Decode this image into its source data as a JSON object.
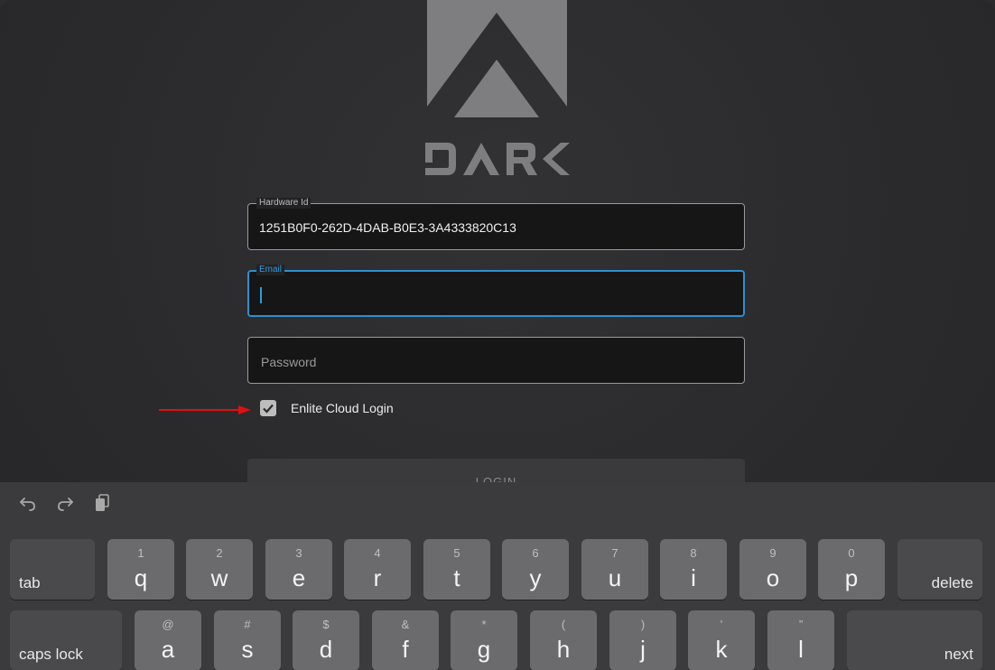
{
  "brand": {
    "wordmark": "DARK",
    "logo": "dark-logo"
  },
  "form": {
    "hardware_id": {
      "label": "Hardware Id",
      "value": "1251B0F0-262D-4DAB-B0E3-3A4333820C13"
    },
    "email": {
      "label": "Email",
      "value": ""
    },
    "password": {
      "placeholder": "Password",
      "value": ""
    },
    "cloud_login": {
      "label": "Enlite Cloud Login",
      "checked": true
    },
    "login_button": "LOGIN"
  },
  "annotation": {
    "arrow_color": "#e01010"
  },
  "colors": {
    "focus": "#2f8fcf",
    "background": "#2b2b2d",
    "field_bg": "#161616"
  },
  "keyboard": {
    "toolbar": [
      "undo-icon",
      "redo-icon",
      "paste-icon"
    ],
    "row1": {
      "left": "tab",
      "keys": [
        {
          "hint": "1",
          "char": "q"
        },
        {
          "hint": "2",
          "char": "w"
        },
        {
          "hint": "3",
          "char": "e"
        },
        {
          "hint": "4",
          "char": "r"
        },
        {
          "hint": "5",
          "char": "t"
        },
        {
          "hint": "6",
          "char": "y"
        },
        {
          "hint": "7",
          "char": "u"
        },
        {
          "hint": "8",
          "char": "i"
        },
        {
          "hint": "9",
          "char": "o"
        },
        {
          "hint": "0",
          "char": "p"
        }
      ],
      "right": "delete"
    },
    "row2": {
      "left": "caps lock",
      "keys": [
        {
          "hint": "@",
          "char": "a"
        },
        {
          "hint": "#",
          "char": "s"
        },
        {
          "hint": "$",
          "char": "d"
        },
        {
          "hint": "&",
          "char": "f"
        },
        {
          "hint": "*",
          "char": "g"
        },
        {
          "hint": "(",
          "char": "h"
        },
        {
          "hint": ")",
          "char": "j"
        },
        {
          "hint": "’",
          "char": "k"
        },
        {
          "hint": "”",
          "char": "l"
        }
      ],
      "right": "next"
    }
  }
}
